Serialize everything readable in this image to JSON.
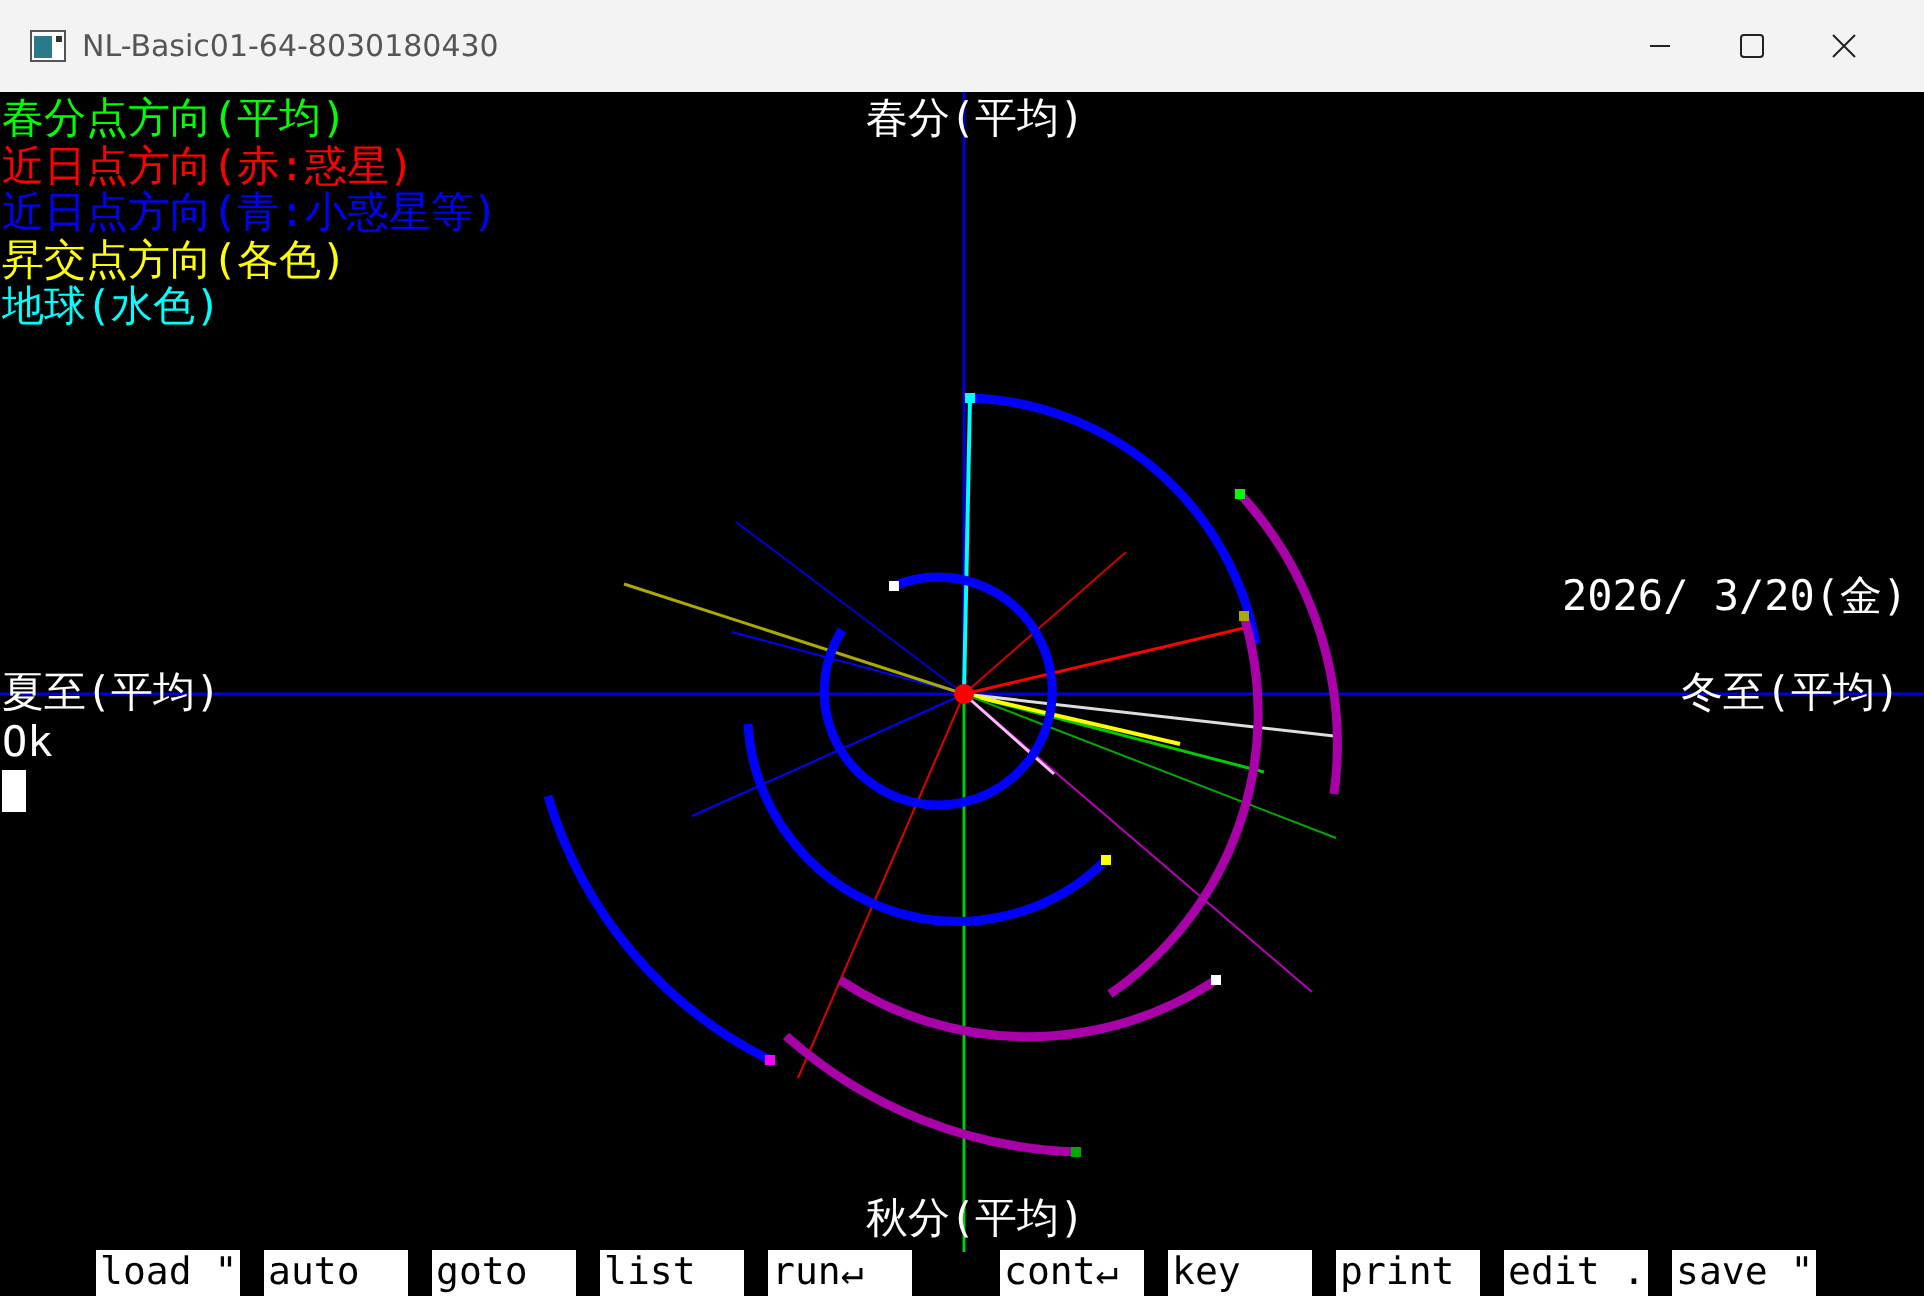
{
  "window": {
    "title": "NL-Basic01-64-8030180430"
  },
  "legend": [
    {
      "label": "春分点方向(平均)",
      "color": "#00ff00"
    },
    {
      "label": "近日点方向(赤:惑星)",
      "color": "#ff0000"
    },
    {
      "label": "近日点方向(青:小惑星等)",
      "color": "#0000ff"
    },
    {
      "label": "昇交点方向(各色)",
      "color": "#ffff00"
    },
    {
      "label": "地球(水色)",
      "color": "#00ffff"
    }
  ],
  "axis_labels": {
    "top": "春分(平均)",
    "bottom": "秋分(平均)",
    "left": "夏至(平均)",
    "right": "冬至(平均)"
  },
  "date": "2026/ 3/20(金)",
  "console": {
    "prompt": "Ok"
  },
  "function_keys": [
    "load \"",
    "auto",
    "goto",
    "list",
    "run↵",
    "cont↵",
    "key",
    "print",
    "edit .",
    "save \""
  ]
}
